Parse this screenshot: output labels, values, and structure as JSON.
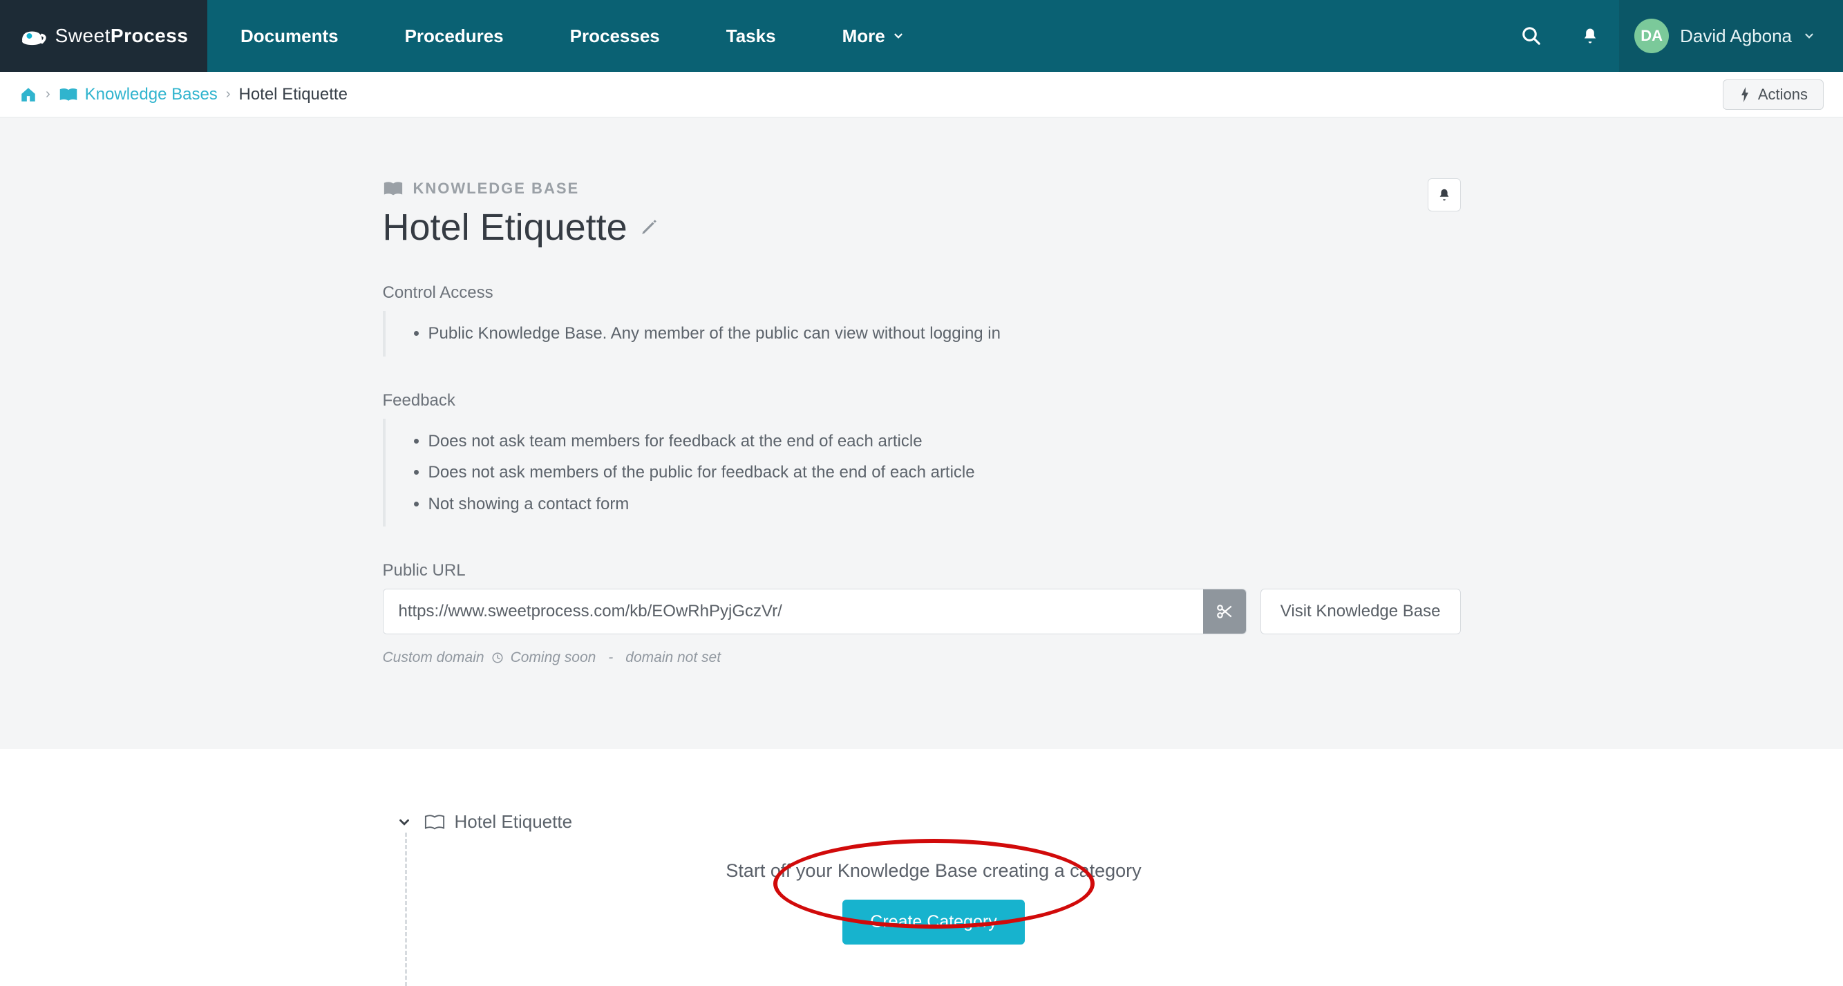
{
  "brand": {
    "name1": "Sweet",
    "name2": "Process"
  },
  "nav": {
    "documents": "Documents",
    "procedures": "Procedures",
    "processes": "Processes",
    "tasks": "Tasks",
    "more": "More"
  },
  "user": {
    "initials": "DA",
    "name": "David Agbona"
  },
  "breadcrumb": {
    "kb_link": "Knowledge Bases",
    "current": "Hotel Etiquette",
    "actions": "Actions"
  },
  "page": {
    "eyebrow": "KNOWLEDGE BASE",
    "title": "Hotel Etiquette",
    "sections": {
      "access": {
        "label": "Control Access",
        "items": [
          "Public Knowledge Base. Any member of the public can view without logging in"
        ]
      },
      "feedback": {
        "label": "Feedback",
        "items": [
          "Does not ask team members for feedback at the end of each article",
          "Does not ask members of the public for feedback at the end of each article",
          "Not showing a contact form"
        ]
      },
      "url": {
        "label": "Public URL",
        "value": "https://www.sweetprocess.com/kb/EOwRhPyjGczVr/",
        "visit": "Visit Knowledge Base"
      },
      "domain": {
        "prefix": "Custom domain",
        "soon": "Coming soon",
        "notset": "domain not set"
      }
    }
  },
  "tree": {
    "root": "Hotel Etiquette",
    "empty_msg": "Start off your Knowledge Base creating a category",
    "create_btn": "Create Category"
  }
}
